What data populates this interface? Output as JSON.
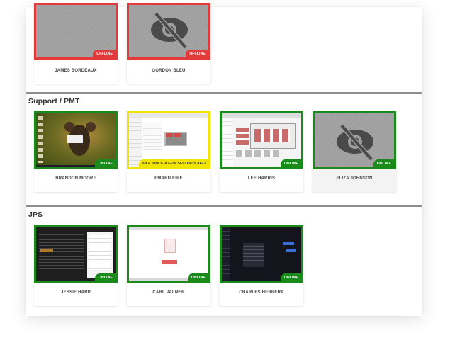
{
  "groups": [
    {
      "title": "",
      "users": [
        {
          "name": "JAMES BORDEAUX",
          "status": "OFFLINE"
        },
        {
          "name": "GORDON BLEU",
          "status": "OFFLINE"
        }
      ]
    },
    {
      "title": "Support / PMT",
      "users": [
        {
          "name": "BRANDON MOORE",
          "status": "ONLINE"
        },
        {
          "name": "EMARU EIRE",
          "status": "IDLE SINCE A FEW SECONDS AGO"
        },
        {
          "name": "LEE HARRIS",
          "status": "ONLINE"
        },
        {
          "name": "ELIZA JOHNSON",
          "status": "ONLINE"
        }
      ]
    },
    {
      "title": "JPS",
      "users": [
        {
          "name": "JESSIE HARP",
          "status": "ONLINE"
        },
        {
          "name": "CARL PALMER",
          "status": "ONLINE"
        },
        {
          "name": "CHARLES HERRERA",
          "status": "ONLINE"
        }
      ]
    }
  ],
  "colors": {
    "online": "#1a8a1a",
    "offline": "#e23a3a",
    "idle": "#f0e400"
  },
  "icons": {
    "hidden_screen": "eye-slash-icon"
  }
}
